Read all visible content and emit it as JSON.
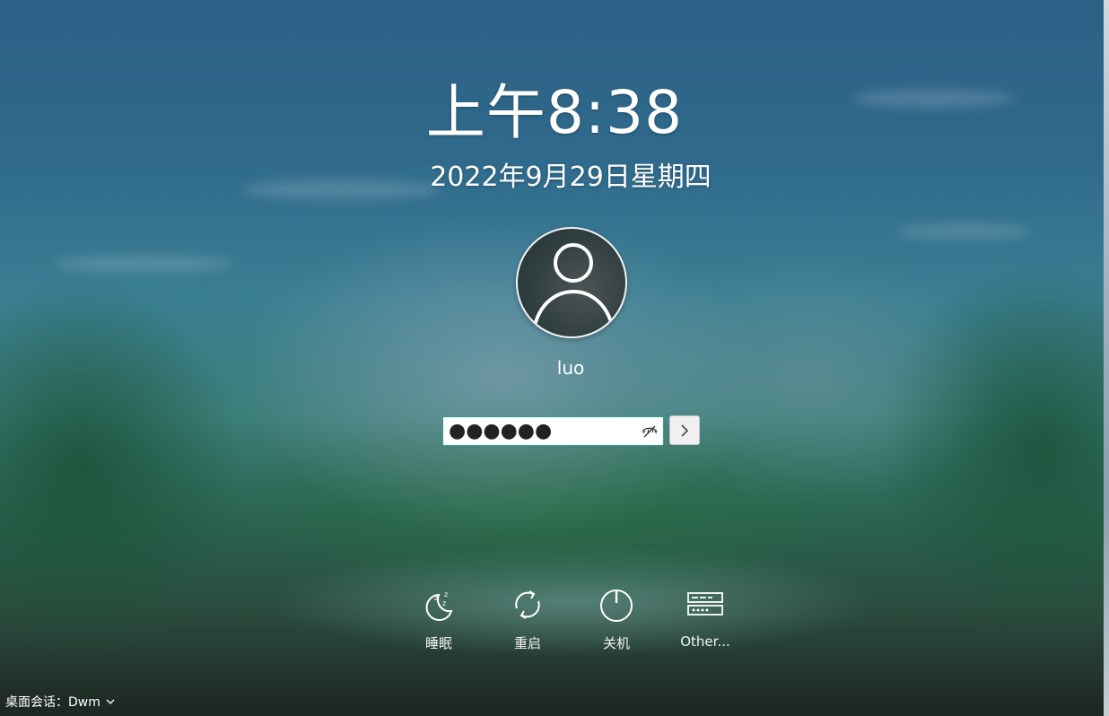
{
  "lockscreen": {
    "time": "上午8:38",
    "date": "2022年9月29日星期四",
    "username": "luo",
    "password_masked": "●●●●●●"
  },
  "actions": [
    {
      "label": "睡眠",
      "icon": "sleep-moon-icon"
    },
    {
      "label": "重启",
      "icon": "restart-icon"
    },
    {
      "label": "关机",
      "icon": "power-icon"
    },
    {
      "label": "Other...",
      "icon": "other-keyboard-icon"
    }
  ],
  "session": {
    "label": "桌面会话：Dwm",
    "icon": "chevron-down-icon"
  },
  "colors": {
    "accent": "#2d9f8e",
    "text": "#ffffff"
  }
}
